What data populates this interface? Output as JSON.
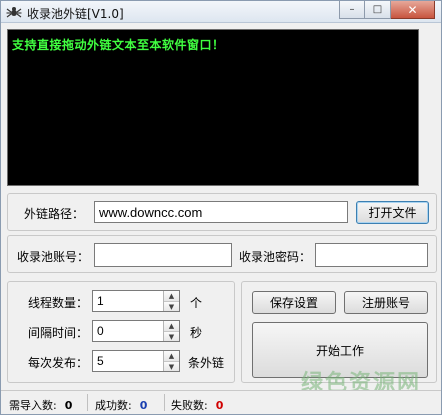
{
  "window": {
    "title": "收录池外链[V1.0]",
    "minimize": "–",
    "maximize": "□",
    "close": "✕"
  },
  "console": {
    "message": "支持直接拖动外链文本至本软件窗口！"
  },
  "link_path": {
    "label": "外链路径：",
    "value": "www.downcc.com",
    "open_button": "打开文件"
  },
  "account": {
    "user_label": "收录池账号：",
    "user_value": "",
    "password_label": "收录池密码：",
    "password_value": ""
  },
  "settings": {
    "threads_label": "线程数量：",
    "threads_value": "1",
    "threads_unit": "个",
    "interval_label": "间隔时间：",
    "interval_value": "0",
    "interval_unit": "秒",
    "per_post_label": "每次发布：",
    "per_post_value": "5",
    "per_post_unit": "条外链"
  },
  "actions": {
    "save_button": "保存设置",
    "register_button": "注册账号",
    "start_button": "开始工作"
  },
  "status": {
    "to_import_label": "需导入数:",
    "to_import_value": "0",
    "success_label": "成功数:",
    "success_value": "0",
    "failed_label": "失败数:",
    "failed_value": "0",
    "colors": {
      "to_import": "#000000",
      "success": "#1a3fb0",
      "failed": "#d00000"
    }
  },
  "watermark": {
    "text": "绿色资源网",
    "url": "www.downcc.com"
  }
}
